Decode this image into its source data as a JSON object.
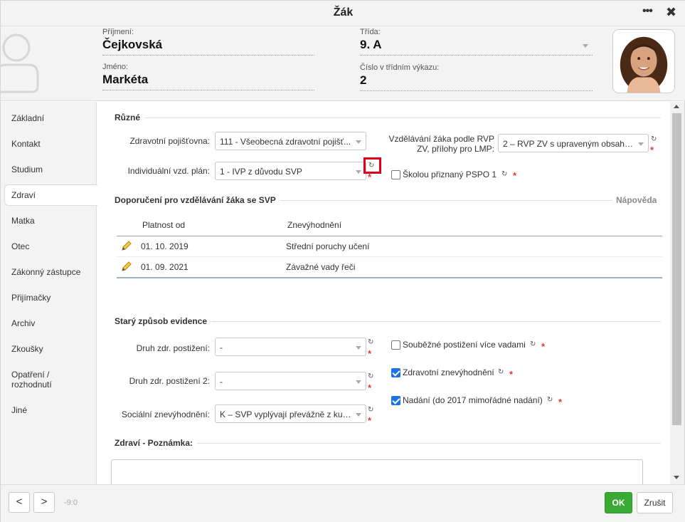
{
  "window": {
    "title": "Žák",
    "menu_label": "•••",
    "close_label": "✖"
  },
  "header": {
    "surname_label": "Příjmení:",
    "surname_value": "Čejkovská",
    "name_label": "Jméno:",
    "name_value": "Markéta",
    "class_label": "Třída:",
    "class_value": "9. A",
    "number_label": "Číslo v třídním výkazu:",
    "number_value": "2"
  },
  "sidebar": {
    "items": [
      {
        "label": "Základní"
      },
      {
        "label": "Kontakt"
      },
      {
        "label": "Studium"
      },
      {
        "label": "Zdraví",
        "active": true
      },
      {
        "label": "Matka"
      },
      {
        "label": "Otec"
      },
      {
        "label": "Zákonný zástupce"
      },
      {
        "label": "Přijímačky"
      },
      {
        "label": "Archiv"
      },
      {
        "label": "Zkoušky"
      },
      {
        "label": "Opatření / rozhodnutí"
      },
      {
        "label": "Jiné"
      }
    ]
  },
  "ruzne": {
    "title": "Různé",
    "insurance_label": "Zdravotní pojišťovna:",
    "insurance_value": "111 - Všeobecná zdravotní pojišť...",
    "plan_label": "Individuální vzd. plán:",
    "plan_value": "1 - IVP z důvodu SVP",
    "rvp_label_line1": "Vzdělávání žáka podle RVP",
    "rvp_label_line2": "ZV, přílohy pro LMP:",
    "rvp_value": "2 – RVP ZV s upraveným obsahe...",
    "pspo_label": "Školou přiznaný PSPO 1",
    "pspo_checked": false
  },
  "doporuceni": {
    "title": "Doporučení pro vzdělávání žáka se SVP",
    "help": "Nápověda",
    "columns": [
      "Platnost od",
      "Znevýhodnění"
    ],
    "rows": [
      {
        "date": "01. 10. 2019",
        "value": "Střední poruchy učení"
      },
      {
        "date": "01. 09. 2021",
        "value": "Závažné vady řeči"
      }
    ]
  },
  "stary": {
    "title": "Starý způsob evidence",
    "druh_label": "Druh zdr. postižení:",
    "druh_value": "-",
    "druh2_label": "Druh zdr. postižení 2:",
    "druh2_value": "-",
    "soc_label": "Sociální znevýhodnění:",
    "soc_value": "K – SVP vyplývají převážně z kul...",
    "soubezne_label": "Souběžné postižení více vadami",
    "soubezne_checked": false,
    "zdr_label": "Zdravotní znevýhodnění",
    "zdr_checked": true,
    "nadani_label": "Nadání (do 2017 mimořádné nadání)",
    "nadani_checked": true
  },
  "poznamka": {
    "title": "Zdraví - Poznámka:"
  },
  "footer": {
    "prev": "<",
    "next": ">",
    "counter": "-9:0",
    "ok": "OK",
    "cancel": "Zrušit"
  },
  "colors": {
    "accent_green": "#3aaa35",
    "required_red": "#e53935",
    "highlight_red": "#e0001b",
    "checkbox_blue": "#1a73e8"
  }
}
